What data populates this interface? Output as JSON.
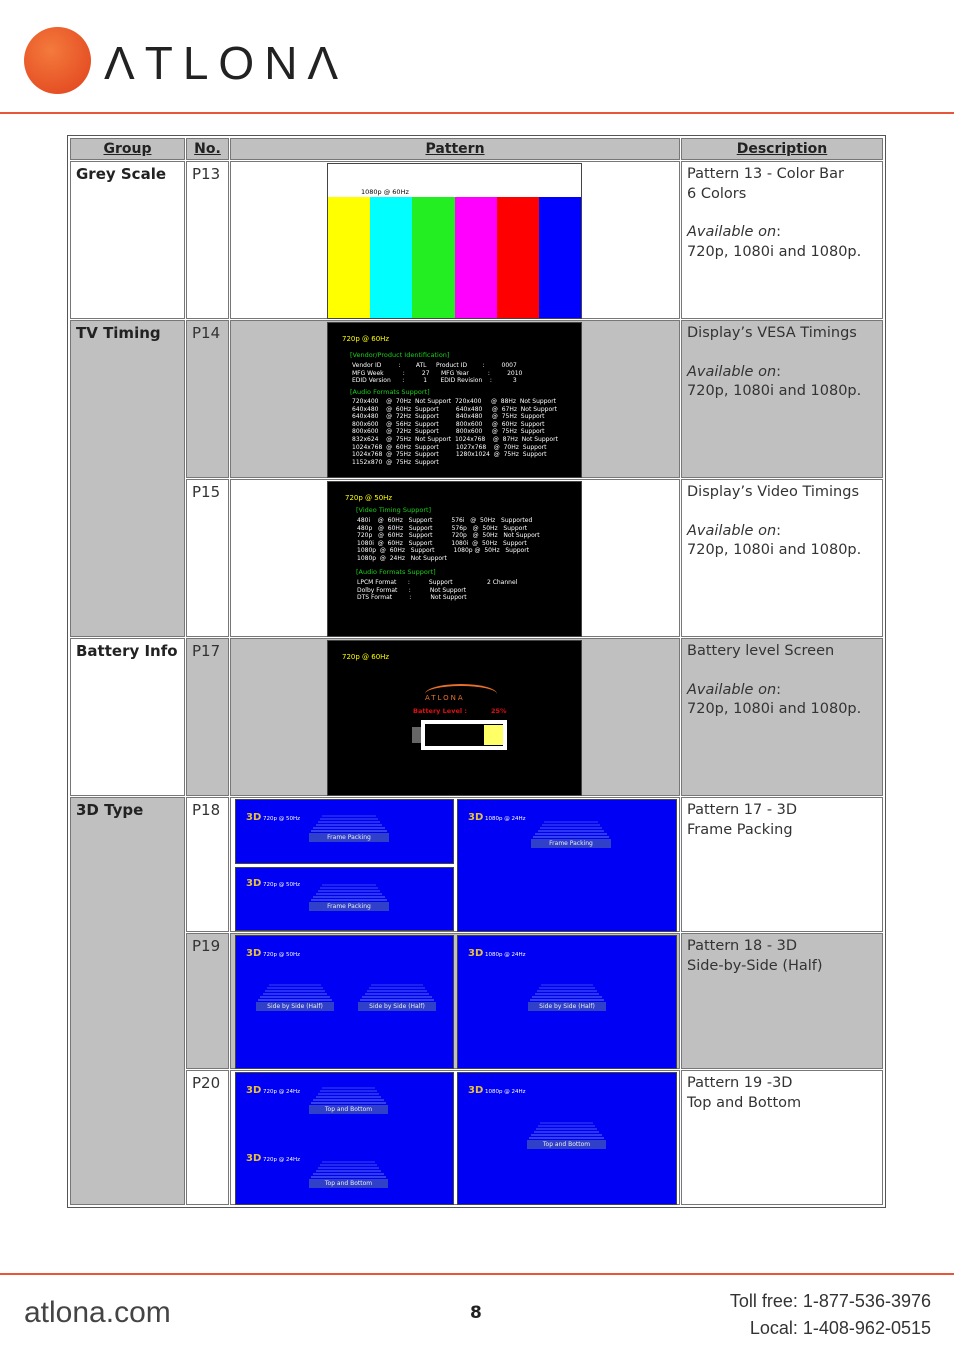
{
  "brand": {
    "name": "ATLONA",
    "registered": "®",
    "accent": "#e8553a"
  },
  "table": {
    "headers": [
      "Group",
      "No.",
      "Pattern",
      "Description"
    ],
    "groups": [
      "Grey Scale",
      "TV Timing",
      "Battery Info",
      "3D Type"
    ],
    "rows": [
      {
        "no": "P13",
        "desc": [
          "Pattern 13 - Color Bar",
          "6 Colors"
        ],
        "avail": "Available on",
        "res": "720p, 1080i and 1080p."
      },
      {
        "no": "P14",
        "desc": [
          "Display’s VESA Timings"
        ],
        "avail": "Available on",
        "res": "720p, 1080i and 1080p."
      },
      {
        "no": "P15",
        "desc": [
          "Display’s Video Timings"
        ],
        "avail": "Available on",
        "res": "720p, 1080i and 1080p."
      },
      {
        "no": "P17",
        "desc": [
          "Battery level Screen"
        ],
        "avail": "Available on",
        "res": "720p, 1080i and 1080p."
      },
      {
        "no": "P18",
        "desc": [
          "Pattern 17 - 3D",
          "Frame Packing"
        ]
      },
      {
        "no": "P19",
        "desc": [
          "Pattern 18 - 3D",
          "Side-by-Side (Half)"
        ]
      },
      {
        "no": "P20",
        "desc": [
          "Pattern 19 -3D",
          "Top and Bottom"
        ]
      }
    ]
  },
  "p13": {
    "label": "1080p @ 60Hz",
    "colors": [
      "#ffff00",
      "#00ffff",
      "#22ee22",
      "#ff00ff",
      "#ff0000",
      "#0000ff"
    ]
  },
  "p14": {
    "res": "720p @ 60Hz",
    "sec1": "[Vendor/Product Identification]",
    "vendor": "Vendor ID         :        ATL     Product ID        :         0007\nMFG Week          :         27      MFG Year          :         2010\nEDID Version      :          1       EDID Revision    :           3",
    "sec2": "[Audio Formats Support]",
    "timings": "720x400    @  70Hz  Not Support  720x400     @  88Hz  Not Support\n640x480    @  60Hz  Support         640x480     @  67Hz  Not Support\n640x480    @  72Hz  Support         840x480     @  75Hz  Support\n800x600    @  56Hz  Support         800x600     @  60Hz  Support\n800x600    @  72Hz  Support         800x600     @  75Hz  Support\n832x624    @  75Hz  Not Support  1024x768    @  87Hz  Not Support\n1024x768  @  60Hz  Support         1027x768    @  70Hz  Support\n1024x768  @  75Hz  Support         1280x1024  @  75Hz  Support\n1152x870  @  75Hz  Support"
  },
  "p15": {
    "res": "720p @ 50Hz",
    "sec1": "[Video Timing Support]",
    "timings": "480i    @  60Hz   Support          576i   @  50Hz   Supported\n480p   @  60Hz   Support          576p   @  50Hz   Support\n720p   @  60Hz   Support          720p   @  50Hz   Not Support\n1080i  @  60Hz   Support          1080i  @  50Hz   Support\n1080p  @  60Hz   Support          1080p @  50Hz   Support\n1080p  @  24Hz   Not Support",
    "sec2": "[Audio Formats Support]",
    "audio": "LPCM Format      :          Support                  2 Channel\nDolby Format      :          Not Support\nDTS Format         :          Not Support"
  },
  "p17": {
    "res": "720p @ 60Hz",
    "logo": "ATLONA",
    "battery_label": "Battery  Level :",
    "battery_value": "25%",
    "battery_level": 0.25
  },
  "p3d": {
    "tag": "3D",
    "p18": [
      {
        "res": "720p @ 50Hz",
        "label": "Frame Packing"
      },
      {
        "res": "720p @ 50Hz",
        "label": "Frame Packing"
      },
      {
        "res": "1080p @ 24Hz",
        "label": "Frame Packing"
      }
    ],
    "p19": [
      {
        "res": "720p @ 50Hz",
        "label": "Side by Side (Half)",
        "label2": "Side by Side (Half)"
      },
      {
        "res": "1080p @ 24Hz",
        "label": "Side by Side (Half)"
      }
    ],
    "p20": [
      {
        "res": "720p @ 24Hz",
        "label": "Top and Bottom"
      },
      {
        "res": "720p @ 24Hz",
        "label": "Top and Bottom"
      },
      {
        "res": "1080p @ 24Hz",
        "label": "Top and Bottom"
      }
    ]
  },
  "footer": {
    "site": "atlona.com",
    "page": "8",
    "tollfree": "Toll free: 1-877-536-3976",
    "local": "Local: 1-408-962-0515"
  }
}
